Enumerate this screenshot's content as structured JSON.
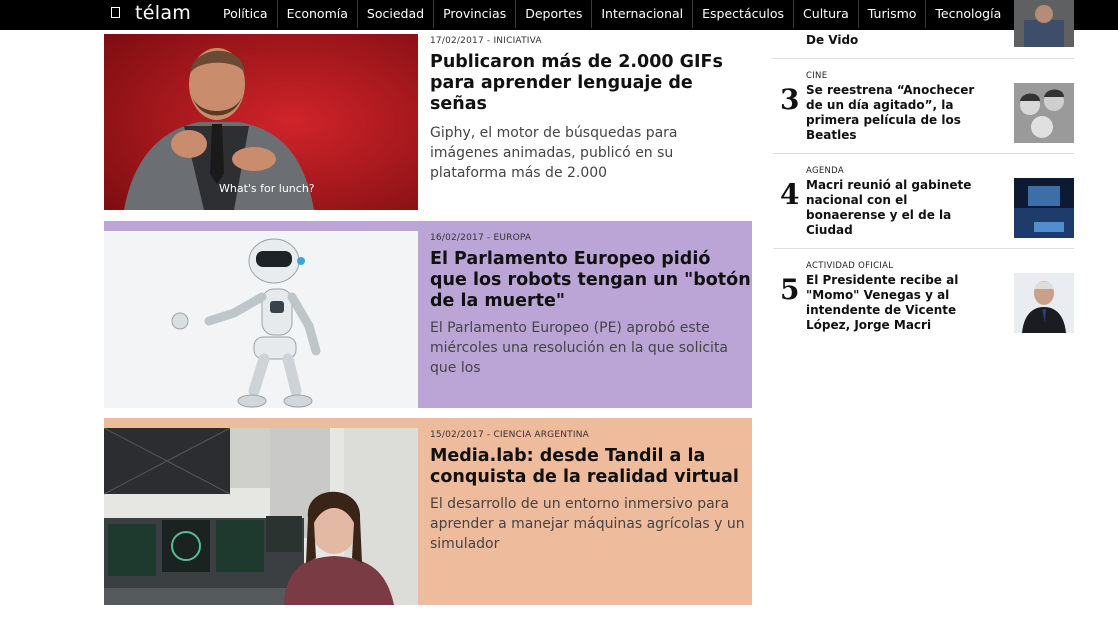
{
  "header": {
    "brand": "télam",
    "nav": [
      "Política",
      "Economía",
      "Sociedad",
      "Provincias",
      "Deportes",
      "Internacional",
      "Espectáculos",
      "Cultura",
      "Turismo",
      "Tecnología"
    ]
  },
  "articles": [
    {
      "meta": "17/02/2017 - INICIATIVA",
      "title": "Publicaron más de 2.000 GIFs para aprender lenguaje de señas",
      "summary": "Giphy, el motor de búsquedas para imágenes animadas, publicó en su plataforma más de 2.000",
      "caption": "What's for lunch?",
      "bg": "#ffffff"
    },
    {
      "meta": "16/02/2017 - EUROPA",
      "title": "El Parlamento Europeo pidió que los robots tengan un \"botón de la muerte\"",
      "summary": "El Parlamento Europeo (PE) aprobó este miércoles una resolución en la que solicita que los",
      "bg": "#bba5d6"
    },
    {
      "meta": "15/02/2017 - CIENCIA ARGENTINA",
      "title": "Media.lab: desde Tandil a la conquista de la realidad virtual",
      "summary": "El desarrollo de un entorno inmersivo para aprender a manejar máquinas agrícolas y un simulador",
      "bg": "#efbb9d"
    }
  ],
  "sidebar": {
    "items": [
      {
        "rank": "",
        "tag": "",
        "title": "De Vido"
      },
      {
        "rank": "3",
        "tag": "CINE",
        "title": "Se reestrena “Anochecer de un día agitado”, la primera película de los Beatles"
      },
      {
        "rank": "4",
        "tag": "AGENDA",
        "title": "Macri reunió al gabinete nacional con el bonaerense y el de la Ciudad"
      },
      {
        "rank": "5",
        "tag": "ACTIVIDAD OFICIAL",
        "title": "El Presidente recibe al \"Momo\" Venegas y al intendente de Vicente López, Jorge Macri"
      }
    ]
  }
}
